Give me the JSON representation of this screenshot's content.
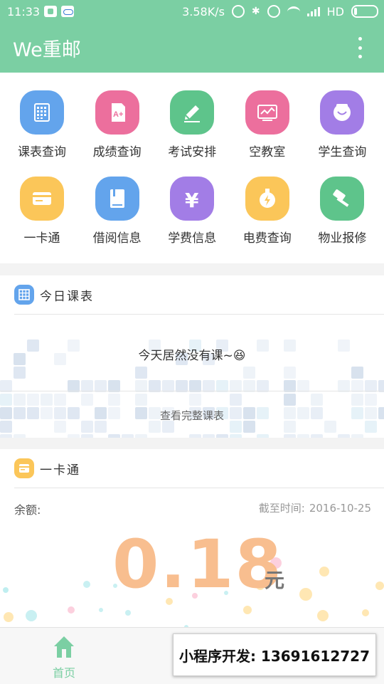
{
  "status_bar": {
    "time": "11:33",
    "speed": "3.58K/s",
    "network": "HD",
    "icons": [
      "shield-icon",
      "cloud-icon",
      "sync-icon",
      "bluetooth-icon",
      "alarm-icon",
      "wifi-icon",
      "signal-icon",
      "battery-icon"
    ]
  },
  "app_bar": {
    "title": "We重邮",
    "menu_icon": "more-vert-icon"
  },
  "grid": [
    {
      "label": "课表查询",
      "icon": "calendar-grid-icon",
      "color": "#63a4ec"
    },
    {
      "label": "成绩查询",
      "icon": "grade-report-icon",
      "color": "#ec6f9d"
    },
    {
      "label": "考试安排",
      "icon": "pencil-icon",
      "color": "#5ec48b"
    },
    {
      "label": "空教室",
      "icon": "classroom-board-icon",
      "color": "#ec6f9d"
    },
    {
      "label": "学生查询",
      "icon": "student-face-icon",
      "color": "#a27de6"
    },
    {
      "label": "一卡通",
      "icon": "card-icon",
      "color": "#fbc659"
    },
    {
      "label": "借阅信息",
      "icon": "book-icon",
      "color": "#63a4ec"
    },
    {
      "label": "学费信息",
      "icon": "yen-icon",
      "color": "#a27de6"
    },
    {
      "label": "电费查询",
      "icon": "electricity-icon",
      "color": "#fbc659"
    },
    {
      "label": "物业报修",
      "icon": "hammer-icon",
      "color": "#5ec48b"
    }
  ],
  "today_schedule": {
    "title": "今日课表",
    "icon": "calendar-grid-icon",
    "icon_color": "#63a4ec",
    "empty_text": "今天居然没有课~",
    "empty_emoji": "😆",
    "view_full": "查看完整课表"
  },
  "card": {
    "title": "一卡通",
    "icon": "card-icon",
    "icon_color": "#fbc659",
    "balance_label": "余额:",
    "as_of_label": "截至时间:",
    "as_of_date": "2016-10-25",
    "amount": "0.18",
    "unit": "元",
    "amount_color": "#f8be8f"
  },
  "bottom_nav": {
    "home_label": "首页",
    "home_icon": "home-icon",
    "accent": "#7bcfa3"
  },
  "promo": {
    "text": "小程序开发: 13691612727"
  }
}
